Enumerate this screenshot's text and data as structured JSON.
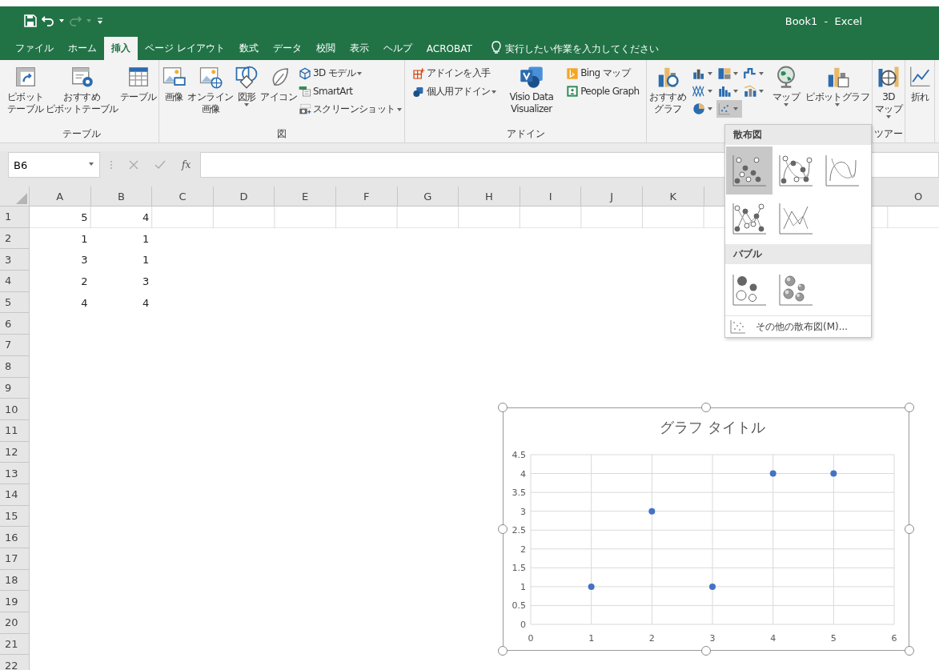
{
  "window": {
    "title": "Book1  -  Excel"
  },
  "quick_access": {
    "undo": {
      "disabled": false
    },
    "redo": {
      "disabled": true
    }
  },
  "tabs": [
    {
      "label": "ファイル",
      "selected": false
    },
    {
      "label": "ホーム",
      "selected": false
    },
    {
      "label": "挿入",
      "selected": true
    },
    {
      "label": "ページ レイアウト",
      "selected": false
    },
    {
      "label": "数式",
      "selected": false
    },
    {
      "label": "データ",
      "selected": false
    },
    {
      "label": "校閲",
      "selected": false
    },
    {
      "label": "表示",
      "selected": false
    },
    {
      "label": "ヘルプ",
      "selected": false
    },
    {
      "label": "ACROBAT",
      "selected": false
    }
  ],
  "tell_me": {
    "placeholder": "実行したい作業を入力してください"
  },
  "ribbon": {
    "groups": [
      {
        "label": "テーブル",
        "items": [
          {
            "kind": "large",
            "lines": [
              "ピボット",
              "テーブル"
            ],
            "dropdown": false
          },
          {
            "kind": "large",
            "lines": [
              "おすすめ",
              "ピボットテーブル"
            ],
            "dropdown": false
          },
          {
            "kind": "large",
            "lines": [
              "テーブル"
            ],
            "dropdown": false
          }
        ]
      },
      {
        "label": "図",
        "items": [
          {
            "kind": "large",
            "lines": [
              "画像"
            ],
            "dropdown": false
          },
          {
            "kind": "large",
            "lines": [
              "オンライン",
              "画像"
            ],
            "dropdown": false
          },
          {
            "kind": "large",
            "lines": [
              "図形"
            ],
            "dropdown": true
          },
          {
            "kind": "large",
            "lines": [
              "アイコン"
            ],
            "dropdown": false
          },
          {
            "kind": "stack",
            "items": [
              {
                "label": "3D モデル",
                "dropdown": true
              },
              {
                "label": "SmartArt",
                "dropdown": false
              },
              {
                "label": "スクリーンショット",
                "dropdown": true
              }
            ]
          }
        ]
      },
      {
        "label": "アドイン",
        "items": [
          {
            "kind": "stack",
            "items": [
              {
                "label": "アドインを入手",
                "dropdown": false
              },
              {
                "label": "個人用アドイン",
                "dropdown": true
              }
            ]
          },
          {
            "kind": "large",
            "lines": [
              "Visio Data",
              "Visualizer"
            ],
            "dropdown": false
          },
          {
            "kind": "stack",
            "items": [
              {
                "label": "Bing マップ",
                "dropdown": false
              },
              {
                "label": "People Graph",
                "dropdown": false
              }
            ]
          }
        ]
      },
      {
        "items": [
          {
            "kind": "large",
            "lines": [
              "おすすめ",
              "グラフ"
            ],
            "dropdown": false
          },
          {
            "kind": "gallery",
            "items": [
              {
                "dropdown": true,
                "selected": false
              },
              {
                "dropdown": true,
                "selected": false
              },
              {
                "dropdown": true,
                "selected": false
              },
              {
                "dropdown": true,
                "selected": false
              },
              {
                "dropdown": true,
                "selected": false
              },
              {
                "dropdown": true,
                "selected": false
              },
              {
                "dropdown": true,
                "selected": false
              },
              {
                "dropdown": true,
                "selected": true
              }
            ]
          },
          {
            "kind": "large",
            "lines": [
              "マップ"
            ],
            "dropdown": true
          },
          {
            "kind": "large",
            "lines": [
              "ピボットグラフ"
            ],
            "dropdown": true
          }
        ]
      },
      {
        "label": "ツアー",
        "items": [
          {
            "kind": "large",
            "lines": [
              "3D",
              "マップ"
            ],
            "dropdown": true
          }
        ]
      },
      {
        "items": [
          {
            "kind": "large",
            "lines": [
              "折れ"
            ],
            "dropdown": false
          }
        ]
      }
    ]
  },
  "formula_bar": {
    "name_box": "B6",
    "function_label": "fx"
  },
  "sheet": {
    "columns": [
      {
        "label": "A"
      },
      {
        "label": "B"
      },
      {
        "label": "C"
      },
      {
        "label": "D"
      },
      {
        "label": "E"
      },
      {
        "label": "F"
      },
      {
        "label": "G"
      },
      {
        "label": "H"
      },
      {
        "label": "I"
      },
      {
        "label": "J"
      },
      {
        "label": "K"
      },
      {},
      {},
      {},
      {
        "label": "O"
      }
    ],
    "rows": [
      {
        "label": "1",
        "cells": [
          "5",
          "4"
        ]
      },
      {
        "label": "2",
        "cells": [
          "1",
          "1"
        ]
      },
      {
        "label": "3",
        "cells": [
          "3",
          "1"
        ]
      },
      {
        "label": "4",
        "cells": [
          "2",
          "3"
        ]
      },
      {
        "label": "5",
        "cells": [
          "4",
          "4"
        ]
      },
      {
        "label": "6"
      },
      {
        "label": "7"
      },
      {
        "label": "8"
      },
      {
        "label": "9"
      },
      {
        "label": "10"
      },
      {
        "label": "11"
      },
      {
        "label": "12"
      },
      {
        "label": "13"
      },
      {
        "label": "14"
      },
      {
        "label": "15"
      },
      {
        "label": "16"
      },
      {
        "label": "17"
      },
      {
        "label": "18"
      },
      {
        "label": "19"
      },
      {
        "label": "20"
      },
      {
        "label": "21"
      },
      {
        "label": "22"
      }
    ]
  },
  "chart": {
    "chart_data": {
      "type": "scatter",
      "title": "グラフ タイトル",
      "x": [
        1,
        2,
        3,
        4,
        5
      ],
      "series": [
        {
          "color": "#4472c4",
          "values": [
            1,
            3,
            1,
            4,
            4
          ]
        }
      ],
      "grid": true,
      "xlim": [
        0,
        6
      ],
      "ylim": [
        0,
        4.5
      ],
      "xticks": [
        0,
        1,
        2,
        3,
        4,
        5,
        6
      ],
      "yticks": [
        0,
        0.5,
        1,
        1.5,
        2,
        2.5,
        3,
        3.5,
        4,
        4.5
      ]
    }
  },
  "scatter_menu": {
    "sections": [
      {
        "header": "散布図",
        "items": [
          {
            "selected": true
          },
          {
            "selected": false
          },
          {
            "selected": false
          },
          {
            "selected": false
          },
          {
            "selected": false
          }
        ]
      },
      {
        "header": "バブル",
        "items": [
          {
            "selected": false
          },
          {
            "selected": false
          }
        ]
      }
    ],
    "more": "その他の散布図(M)..."
  }
}
